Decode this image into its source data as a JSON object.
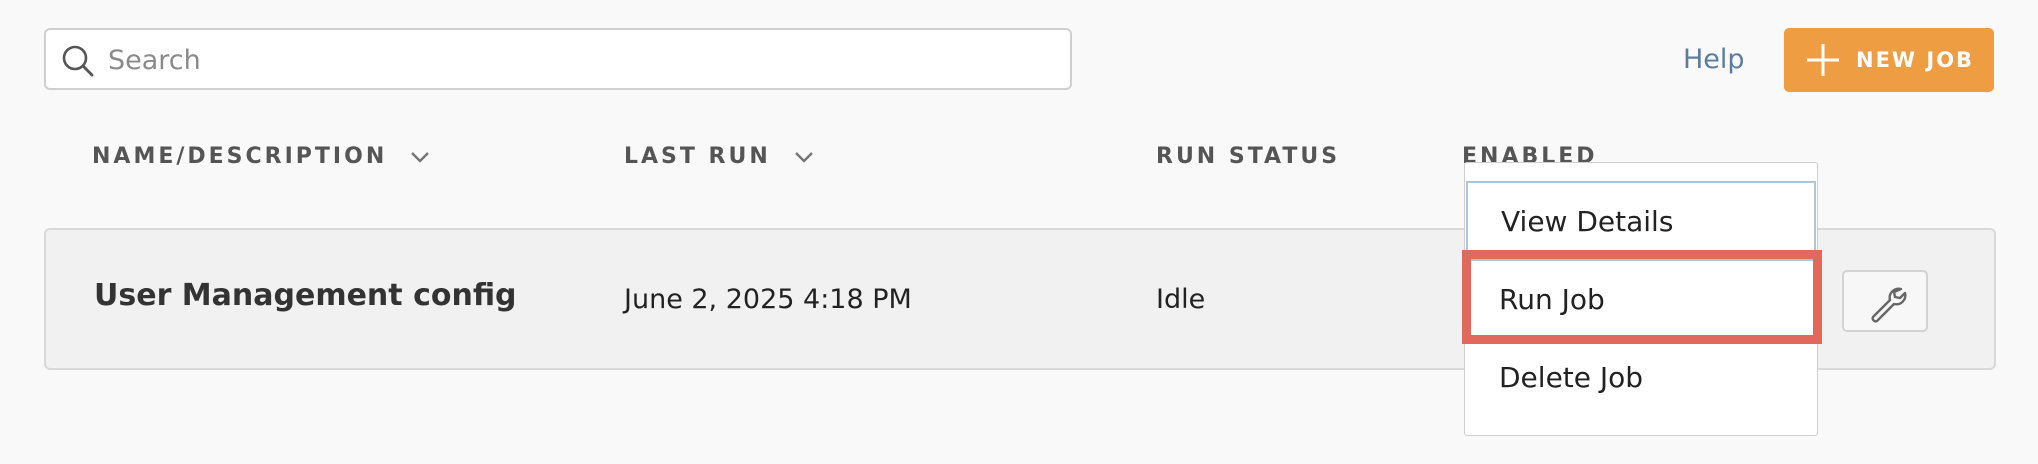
{
  "search": {
    "placeholder": "Search",
    "value": ""
  },
  "header": {
    "help_label": "Help",
    "new_job_label": "NEW JOB"
  },
  "columns": [
    {
      "label": "NAME/DESCRIPTION",
      "sortable": true
    },
    {
      "label": "LAST RUN",
      "sortable": true
    },
    {
      "label": "RUN STATUS",
      "sortable": false
    },
    {
      "label": "ENABLED",
      "sortable": false
    }
  ],
  "jobs": [
    {
      "name": "User Management config",
      "last_run": "June 2, 2025 4:18 PM",
      "status": "Idle"
    }
  ],
  "menu": {
    "items": [
      "View Details",
      "Run Job",
      "Delete Job"
    ],
    "highlighted": "Run Job"
  },
  "colors": {
    "accent": "#ef9d42",
    "link": "#5a7f9e",
    "highlight": "#e0695b",
    "focus_border": "#a9c8e0"
  },
  "icons": [
    "search-icon",
    "plus-icon",
    "chevron-down-icon",
    "wrench-icon"
  ]
}
